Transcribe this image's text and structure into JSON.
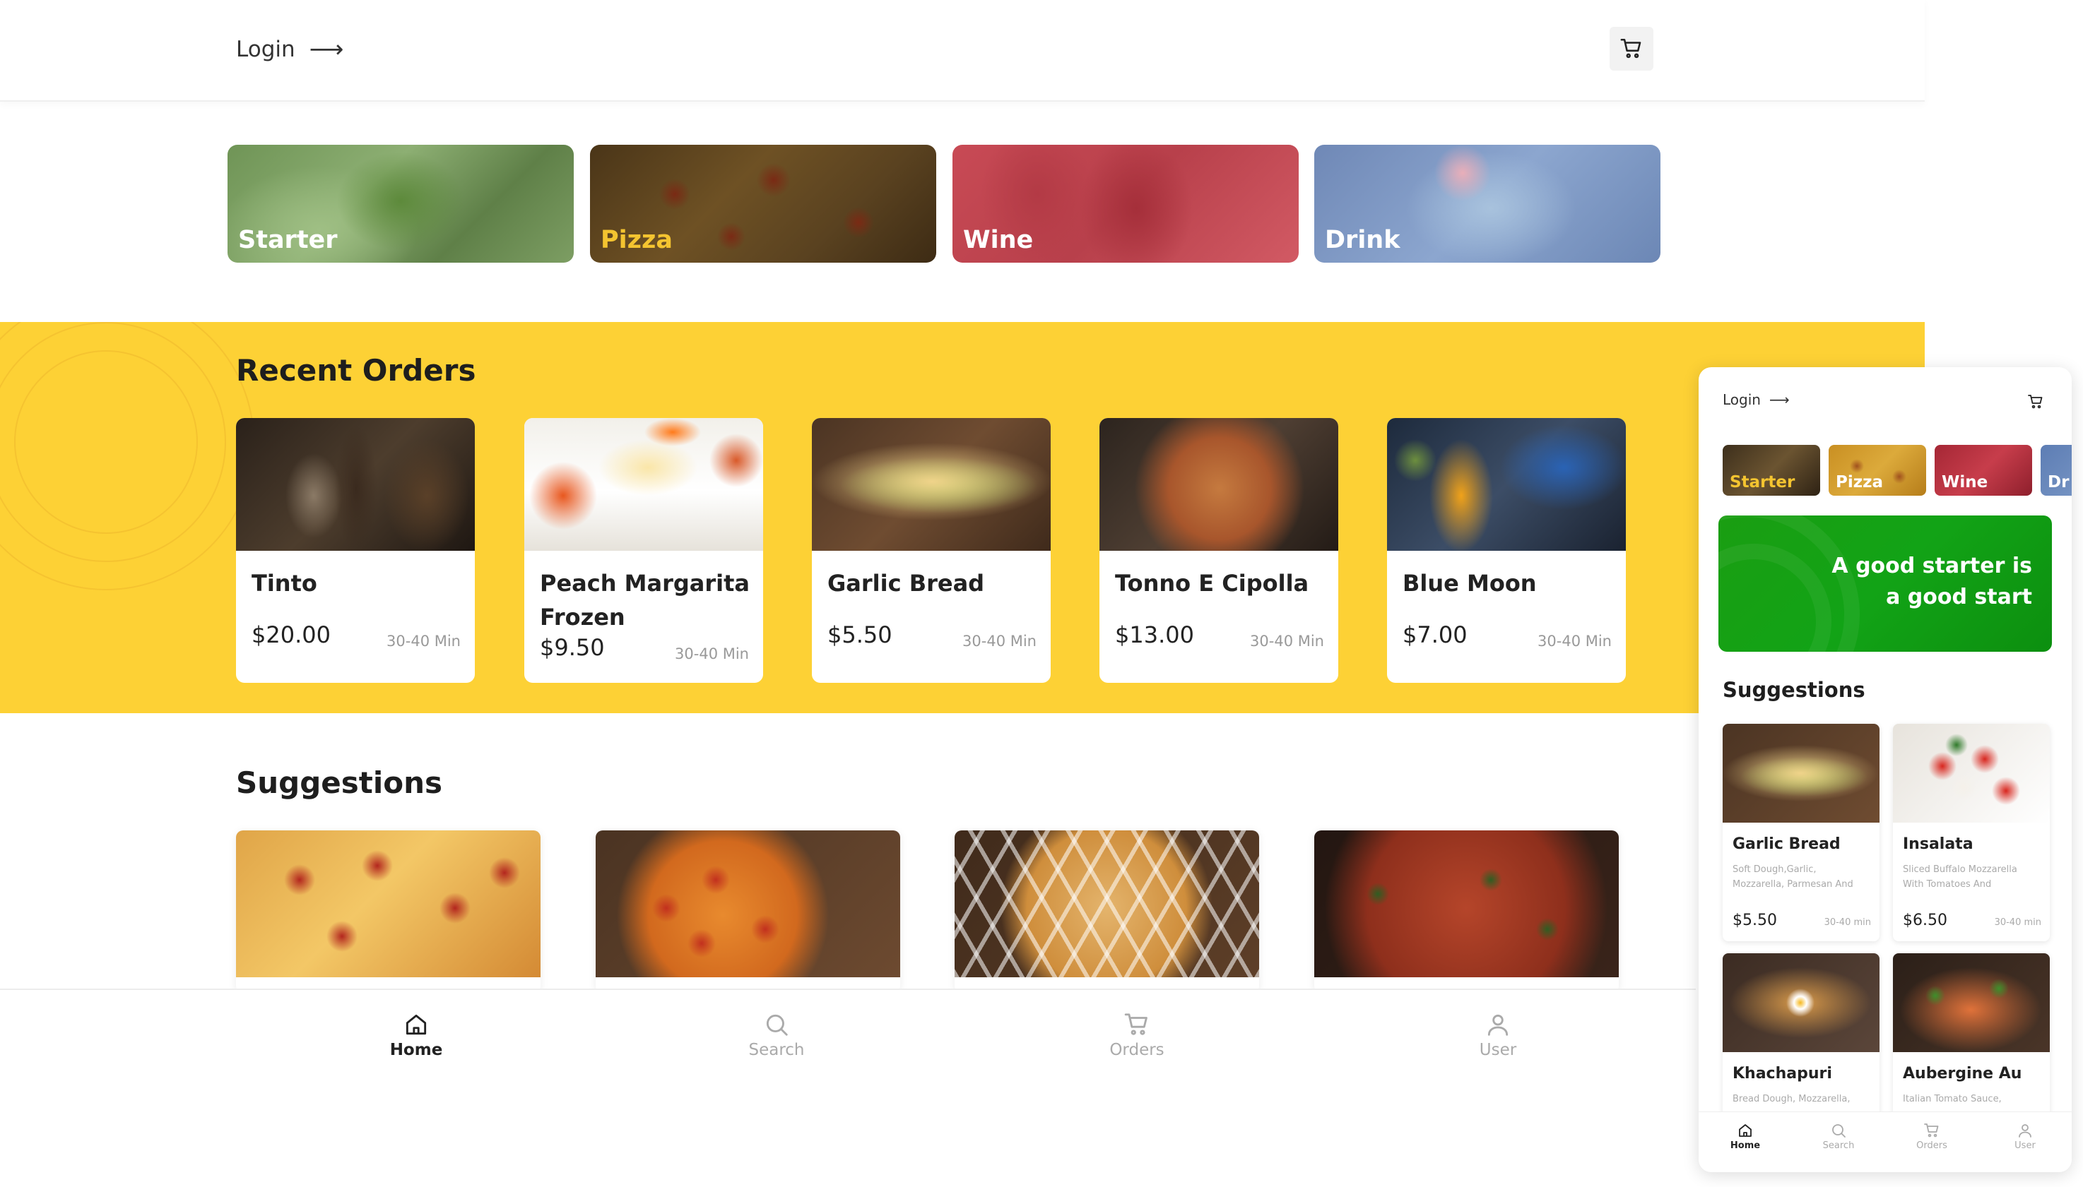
{
  "header": {
    "login_label": "Login",
    "login_arrow": "⟶",
    "cart_icon": "cart-icon"
  },
  "categories": [
    {
      "label": "Starter"
    },
    {
      "label": "Pizza"
    },
    {
      "label": "Wine"
    },
    {
      "label": "Drink"
    }
  ],
  "recent_orders": {
    "title": "Recent Orders",
    "items": [
      {
        "name": "Tinto",
        "price": "$20.00",
        "time": "30-40 Min"
      },
      {
        "name": "Peach Margarita Frozen",
        "price": "$9.50",
        "time": "30-40 Min"
      },
      {
        "name": "Garlic Bread",
        "price": "$5.50",
        "time": "30-40 Min"
      },
      {
        "name": "Tonno E Cipolla",
        "price": "$13.00",
        "time": "30-40 Min"
      },
      {
        "name": "Blue Moon",
        "price": "$7.00",
        "time": "30-40 Min"
      }
    ]
  },
  "suggestions": {
    "title": "Suggestions"
  },
  "nav": {
    "home": "Home",
    "search": "Search",
    "orders": "Orders",
    "user": "User",
    "active": "home"
  },
  "mobile": {
    "login_label": "Login",
    "login_arrow": "⟶",
    "categories": [
      {
        "label": "Starter"
      },
      {
        "label": "Pizza"
      },
      {
        "label": "Wine"
      },
      {
        "label": "Dr"
      }
    ],
    "promo_text": "A good starter is a good start",
    "suggestions_title": "Suggestions",
    "suggestions": [
      {
        "name": "Garlic Bread",
        "desc": "Soft Dough,Garlic, Mozzarella, Parmesan And",
        "price": "$5.50",
        "time": "30-40 min"
      },
      {
        "name": "Insalata",
        "desc": "Sliced Buffalo Mozzarella With Tomatoes And",
        "price": "$6.50",
        "time": "30-40 min"
      },
      {
        "name": "Khachapuri",
        "desc": "Bread Dough, Mozzarella,"
      },
      {
        "name": "Aubergine Au",
        "desc": "Italian Tomato Sauce,"
      }
    ],
    "nav": {
      "home": "Home",
      "search": "Search",
      "orders": "Orders",
      "user": "User"
    }
  },
  "colors": {
    "accent_yellow": "#fdd135",
    "promo_green": "#12a316",
    "text_dark": "#1e1e1e",
    "muted": "#999999"
  }
}
